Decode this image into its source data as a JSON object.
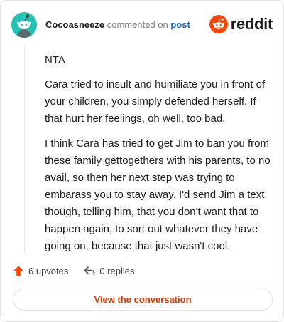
{
  "comment": {
    "username": "Cocoasneeze",
    "action_text": "commented on",
    "post_link": "post",
    "paragraphs": [
      "NTA",
      "Cara tried to insult and humiliate you in front of your children, you simply defended herself. If that hurt her feelings, oh well, too bad.",
      "I think Cara has tried to get Jim to ban you from these family gettogethers with his parents, to no avail, so then her next step was trying to embarass you to stay away. I'd send Jim a text, though, telling him, that you don't want that to happen again, to sort out whatever they have going on, because that just wasn't cool."
    ]
  },
  "brand": {
    "wordmark": "reddit",
    "color": "#ff4500"
  },
  "stats": {
    "upvotes": "6 upvotes",
    "replies": "0 replies"
  },
  "cta": {
    "label": "View the conversation",
    "color": "#d93a00"
  },
  "avatar": {
    "color": "#25c2b3"
  }
}
